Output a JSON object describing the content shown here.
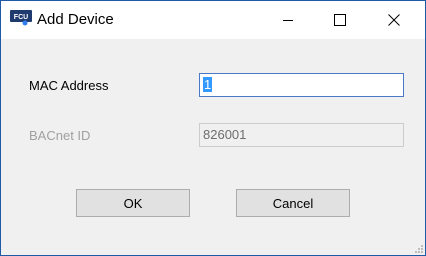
{
  "window": {
    "title": "Add Device",
    "app_icon_text": "FCU",
    "controls": [
      "minimize-icon",
      "maximize-icon",
      "close-icon"
    ]
  },
  "form": {
    "mac_label": "MAC Address",
    "mac_value": "1",
    "bacnet_label": "BACnet ID",
    "bacnet_value": "826001"
  },
  "buttons": {
    "ok_label": "OK",
    "cancel_label": "Cancel"
  },
  "colors": {
    "accent": "#1e5aa8",
    "selection": "#3399ff",
    "disabled_text": "#a0a0a0"
  }
}
